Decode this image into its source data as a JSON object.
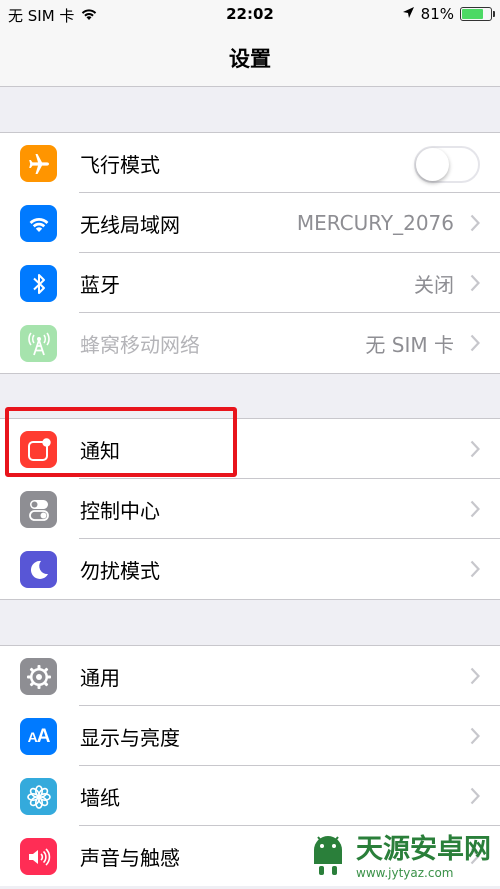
{
  "status_bar": {
    "carrier": "无 SIM 卡",
    "time": "22:02",
    "battery_percent": "81%",
    "battery_level": 0.81
  },
  "nav": {
    "title": "设置"
  },
  "groups": [
    {
      "items": [
        {
          "label": "飞行模式",
          "icon": "airplane-icon",
          "icon_color": "#ff9500",
          "control": "toggle",
          "toggle_on": false
        },
        {
          "label": "无线局域网",
          "icon": "wifi-icon",
          "icon_color": "#007aff",
          "value": "MERCURY_2076"
        },
        {
          "label": "蓝牙",
          "icon": "bluetooth-icon",
          "icon_color": "#007aff",
          "value": "关闭"
        },
        {
          "label": "蜂窝移动网络",
          "icon": "cellular-icon",
          "icon_color": "#a6e3ad",
          "value": "无 SIM 卡",
          "disabled": true
        }
      ]
    },
    {
      "items": [
        {
          "label": "通知",
          "icon": "notifications-icon",
          "icon_color": "#ff3b30"
        },
        {
          "label": "控制中心",
          "icon": "control-center-icon",
          "icon_color": "#8e8e93"
        },
        {
          "label": "勿扰模式",
          "icon": "moon-icon",
          "icon_color": "#5856d6"
        }
      ]
    },
    {
      "items": [
        {
          "label": "通用",
          "icon": "gear-icon",
          "icon_color": "#8e8e93"
        },
        {
          "label": "显示与亮度",
          "icon": "display-brightness-icon",
          "icon_color": "#007aff"
        },
        {
          "label": "墙纸",
          "icon": "wallpaper-icon",
          "icon_color": "#34aadc"
        },
        {
          "label": "声音与触感",
          "icon": "sound-icon",
          "icon_color": "#ff2d55"
        }
      ]
    }
  ],
  "watermark": {
    "text": "天源安卓网",
    "url": "www.jytyaz.com"
  }
}
